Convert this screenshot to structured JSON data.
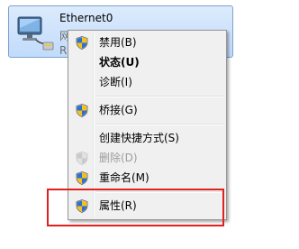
{
  "adapter": {
    "name": "Ethernet0",
    "line2": "网络 17",
    "line3": "R",
    "icon": "network-adapter-icon"
  },
  "menu": {
    "items": [
      {
        "label": "禁用(B)",
        "icon": "uac-shield-icon",
        "bold": false,
        "disabled": false
      },
      {
        "label": "状态(U)",
        "icon": "",
        "bold": true,
        "disabled": false
      },
      {
        "label": "诊断(I)",
        "icon": "",
        "bold": false,
        "disabled": false
      },
      {
        "label": "桥接(G)",
        "icon": "uac-shield-icon",
        "bold": false,
        "disabled": false
      },
      {
        "label": "创建快捷方式(S)",
        "icon": "",
        "bold": false,
        "disabled": false
      },
      {
        "label": "删除(D)",
        "icon": "uac-shield-icon",
        "bold": false,
        "disabled": true
      },
      {
        "label": "重命名(M)",
        "icon": "uac-shield-icon",
        "bold": false,
        "disabled": false
      },
      {
        "label": "属性(R)",
        "icon": "uac-shield-icon",
        "bold": false,
        "disabled": false
      }
    ]
  },
  "colors": {
    "highlight_border": "#e0211f",
    "selection_fill": "#c1dbfc",
    "selection_border": "#7da2ce"
  }
}
